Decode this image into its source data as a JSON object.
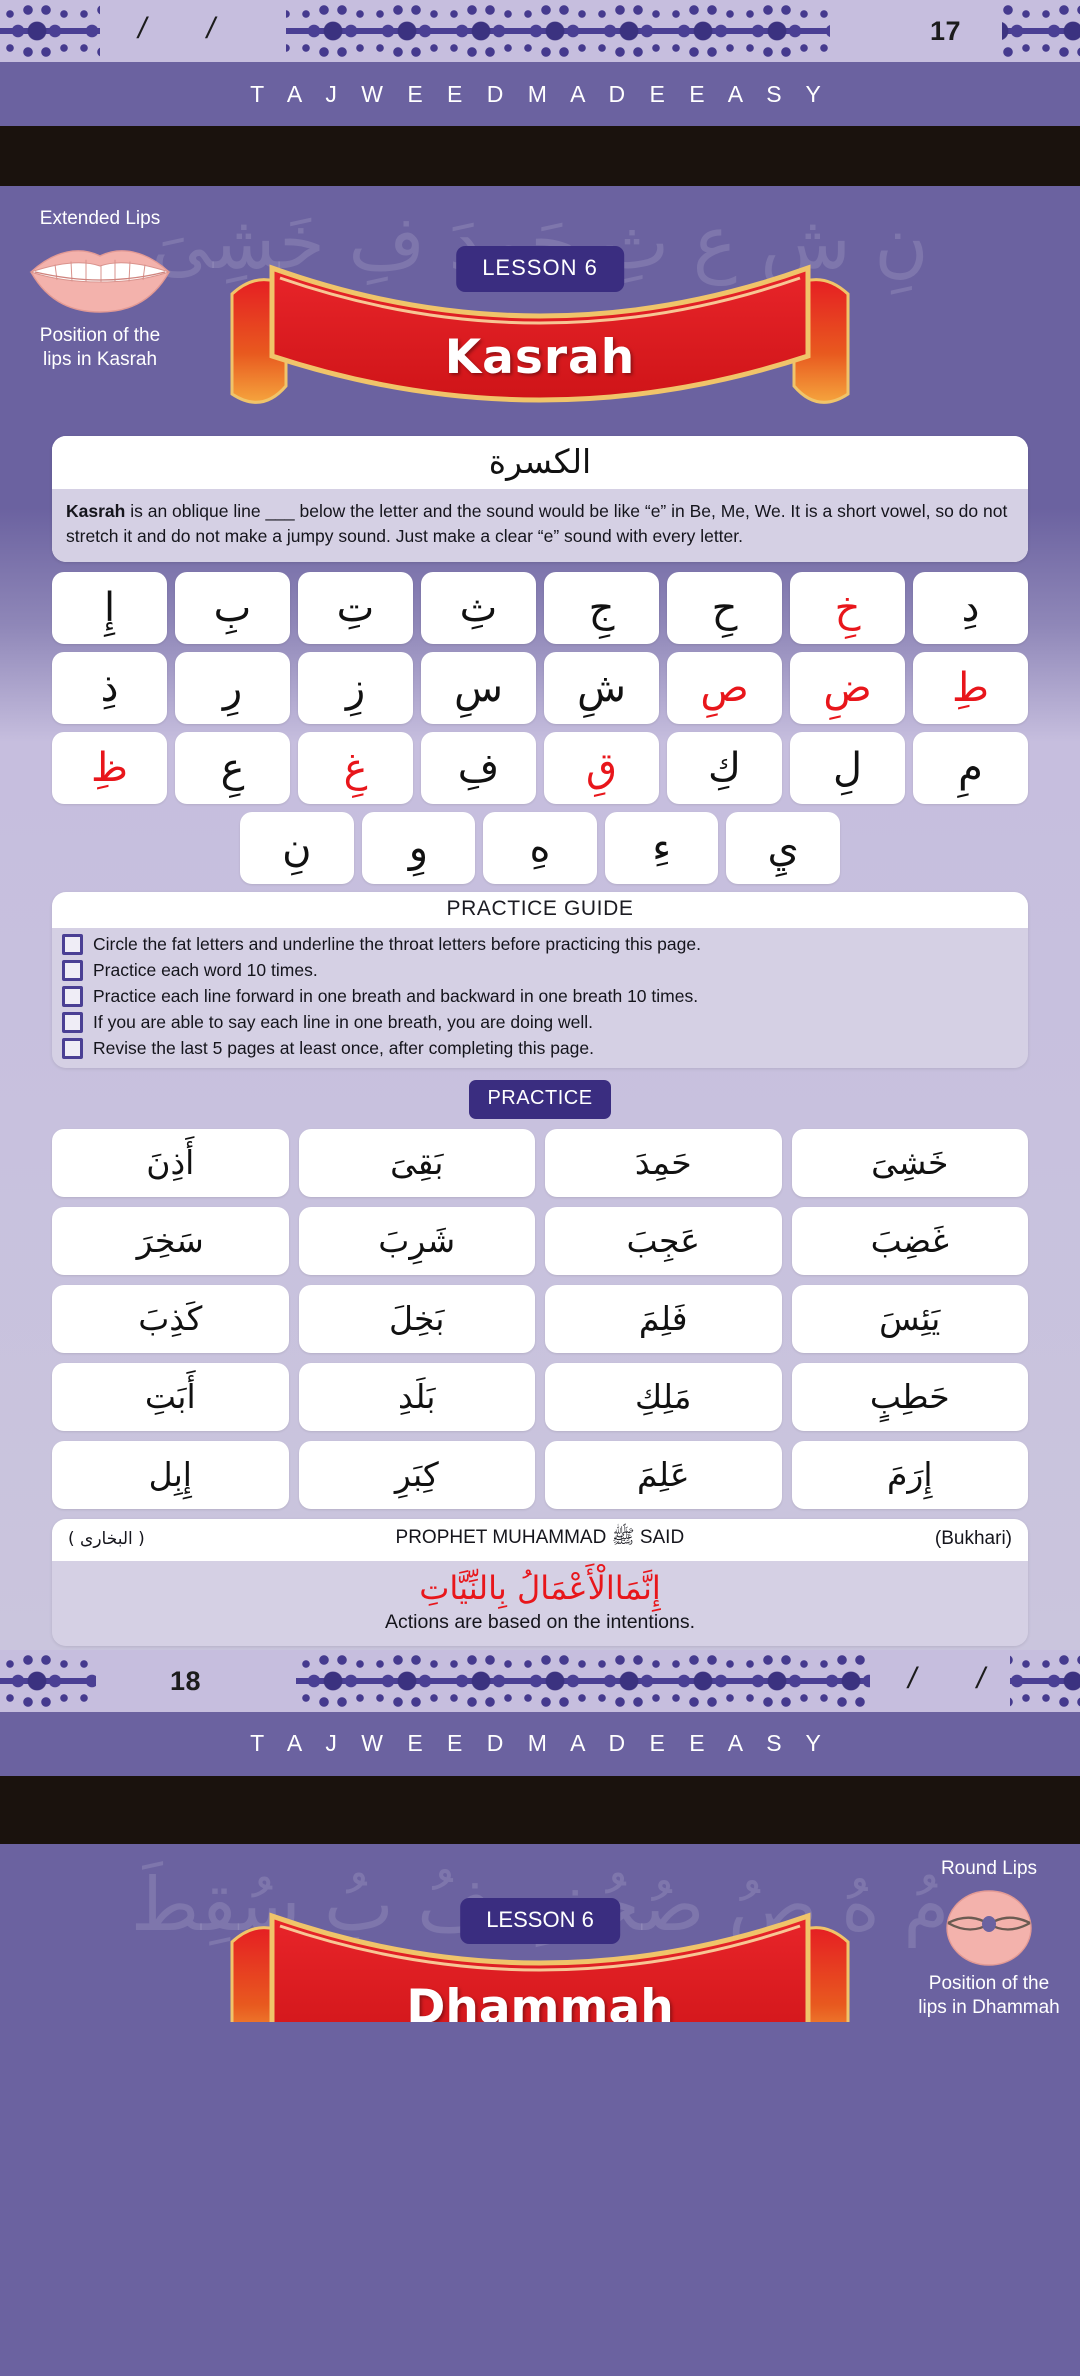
{
  "header": {
    "page_number": "17",
    "slashes": "/    /",
    "brand": "T A J W E E D   M A D E   E A S Y"
  },
  "footer": {
    "page_number": "18",
    "slashes": "/    /",
    "brand": "T A J W E E D   M A D E   E A S Y"
  },
  "hero": {
    "lesson_chip": "LESSON 6",
    "banner_title": "Kasrah",
    "lips_caption_top": "Extended Lips",
    "lips_caption_bottom": "Position of the\nlips in Kasrah",
    "background_letters": "نِ شِ عِ ثِ حَمِدَ فِ خَشِىَ"
  },
  "definition": {
    "arabic_title": "الكسرة",
    "text_before": "Kasrah",
    "text_after": " is an oblique line ___ below the letter and the sound would be like “e” in Be, Me, We. It is a short vowel, so do not stretch it and do not make a jumpy sound. Just make a clear “e” sound with every letter."
  },
  "letter_grid": {
    "rows": [
      [
        {
          "text": "دِ",
          "red": false
        },
        {
          "text": "خِ",
          "red": true
        },
        {
          "text": "حِ",
          "red": false
        },
        {
          "text": "جِ",
          "red": false
        },
        {
          "text": "ثِ",
          "red": false
        },
        {
          "text": "تِ",
          "red": false
        },
        {
          "text": "بِ",
          "red": false
        },
        {
          "text": "إِ",
          "red": false
        }
      ],
      [
        {
          "text": "طِ",
          "red": true
        },
        {
          "text": "ضِ",
          "red": true
        },
        {
          "text": "صِ",
          "red": true
        },
        {
          "text": "شِ",
          "red": false
        },
        {
          "text": "سِ",
          "red": false
        },
        {
          "text": "زِ",
          "red": false
        },
        {
          "text": "رِ",
          "red": false
        },
        {
          "text": "ذِ",
          "red": false
        }
      ],
      [
        {
          "text": "مِ",
          "red": false
        },
        {
          "text": "لِ",
          "red": false
        },
        {
          "text": "كِ",
          "red": false
        },
        {
          "text": "قِ",
          "red": true
        },
        {
          "text": "فِ",
          "red": false
        },
        {
          "text": "غِ",
          "red": true
        },
        {
          "text": "عِ",
          "red": false
        },
        {
          "text": "ظِ",
          "red": true
        }
      ],
      [
        {
          "text": "يِ",
          "red": false
        },
        {
          "text": "ءِ",
          "red": false
        },
        {
          "text": "هِ",
          "red": false
        },
        {
          "text": "وِ",
          "red": false
        },
        {
          "text": "نِ",
          "red": false
        }
      ]
    ]
  },
  "practice_guide": {
    "title": "PRACTICE GUIDE",
    "items": [
      "Circle the fat letters and underline the throat letters before practicing this page.",
      "Practice each word 10 times.",
      "Practice each line forward in one breath and backward in one breath 10 times.",
      "If you are able to say each line in one breath, you are doing well.",
      "Revise the last 5 pages at least once, after completing this page."
    ]
  },
  "practice": {
    "chip": "PRACTICE",
    "rows": [
      [
        "خَشِىَ",
        "حَمِدَ",
        "بَقِىَ",
        "أَذِنَ"
      ],
      [
        "غَضِبَ",
        "عَجِبَ",
        "شَرِبَ",
        "سَخِرَ"
      ],
      [
        "يَئِسَ",
        "فَلِمَ",
        "بَخِلَ",
        "كَذِبَ"
      ],
      [
        "حَطِبٍ",
        "مَلِكِ",
        "بَلَدِ",
        "أَبَتِ"
      ],
      [
        "إِرَمَ",
        "عَلِمَ",
        "كِبَرِ",
        "إِبِل"
      ]
    ]
  },
  "hadith": {
    "source_arabic": "( البخارى )",
    "heading": "PROPHET MUHAMMAD ﷺ SAID",
    "source_english": "(Bukhari)",
    "arabic": "إِنَّمَاالْأَعْمَالُ بِالنِّيَّاتِ",
    "english": "Actions are based on the intentions."
  },
  "next_lesson": {
    "lesson_chip": "LESSON 6",
    "banner_title": "Dhammah",
    "lips_caption_top": "Round Lips",
    "lips_caption_bottom": "Position of the\nlips in Dhammah",
    "background_letters": "مُ هُ صُ صُحُفِ فُ بُ سُقِطَ"
  },
  "colors": {
    "purple": "#6b62a0",
    "lavender": "#cac5dd",
    "band": "#c6bede",
    "chip": "#3a2d80",
    "red": "#e8161b",
    "black": "#1a120d"
  }
}
